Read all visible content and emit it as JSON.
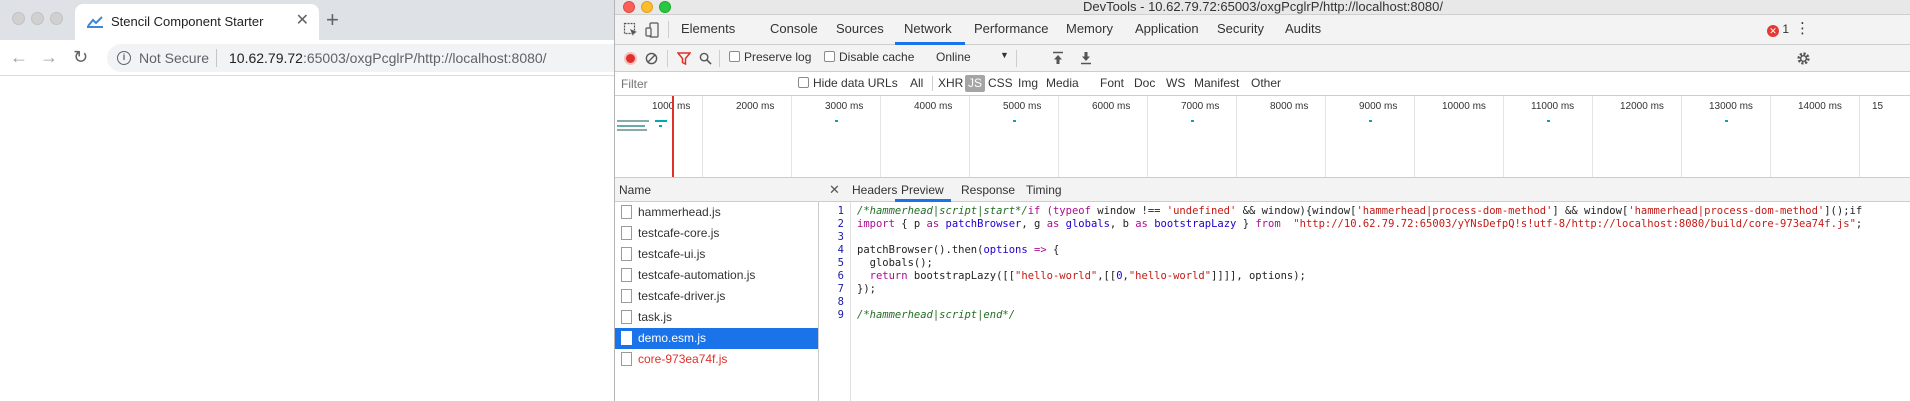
{
  "browser": {
    "tab_title": "Stencil Component Starter",
    "not_secure": "Not Secure",
    "url_host": "10.62.79.72",
    "url_rest": ":65003/oxgPcglrP/http://localhost:8080/"
  },
  "devtools": {
    "window_title": "DevTools - 10.62.79.72:65003/oxgPcglrP/http://localhost:8080/",
    "tabs": [
      "Elements",
      "Console",
      "Sources",
      "Network",
      "Performance",
      "Memory",
      "Application",
      "Security",
      "Audits"
    ],
    "active_tab": "Network",
    "error_count": "1",
    "network_toolbar": {
      "preserve_log": "Preserve log",
      "disable_cache": "Disable cache",
      "throttle": "Online"
    },
    "filter": {
      "placeholder": "Filter",
      "hide_data_urls": "Hide data URLs",
      "types": [
        "All",
        "XHR",
        "JS",
        "CSS",
        "Img",
        "Media",
        "Font",
        "Doc",
        "WS",
        "Manifest",
        "Other"
      ],
      "selected_type": "JS"
    },
    "overview_ticks": [
      "1000 ms",
      "2000 ms",
      "3000 ms",
      "4000 ms",
      "5000 ms",
      "6000 ms",
      "7000 ms",
      "8000 ms",
      "9000 ms",
      "10000 ms",
      "11000 ms",
      "12000 ms",
      "13000 ms",
      "14000 ms",
      "15"
    ],
    "name_header": "Name",
    "requests": [
      {
        "name": "hammerhead.js",
        "state": "normal"
      },
      {
        "name": "testcafe-core.js",
        "state": "normal"
      },
      {
        "name": "testcafe-ui.js",
        "state": "normal"
      },
      {
        "name": "testcafe-automation.js",
        "state": "normal"
      },
      {
        "name": "testcafe-driver.js",
        "state": "normal"
      },
      {
        "name": "task.js",
        "state": "normal"
      },
      {
        "name": "demo.esm.js",
        "state": "selected"
      },
      {
        "name": "core-973ea74f.js",
        "state": "error"
      }
    ],
    "detail_tabs": [
      "Headers",
      "Preview",
      "Response",
      "Timing"
    ],
    "active_detail_tab": "Preview",
    "line_numbers": [
      "1",
      "2",
      "3",
      "4",
      "5",
      "6",
      "7",
      "8",
      "9"
    ],
    "code": {
      "l1_comment": "/*hammerhead|script|start*/",
      "l1_rest_a": "if (",
      "l1_typeof": "typeof",
      "l1_rest_b": " window !== ",
      "l1_str1": "'undefined'",
      "l1_rest_c": " && window){window[",
      "l1_str2": "'hammerhead|process-dom-method'",
      "l1_rest_d": "] && window[",
      "l1_str3": "'hammerhead|process-dom-method'",
      "l1_rest_e": "]();if",
      "l2_import": "import",
      "l2_rest_a": " { p ",
      "l2_as1": "as",
      "l2_v1": " patchBrowser",
      "l2_rest_b": ", g ",
      "l2_as2": "as",
      "l2_v2": " globals",
      "l2_rest_c": ", b ",
      "l2_as3": "as",
      "l2_v3": " bootstrapLazy",
      "l2_rest_d": " } ",
      "l2_from": "from",
      "l2_str": "  \"http://10.62.79.72:65003/yYNsDefpQ!s!utf-8/http://localhost:8080/build/core-973ea74f.js\"",
      "l2_end": ";",
      "l4_a": "patchBrowser().then(",
      "l4_opt": "options",
      "l4_arrow": " => ",
      "l4_b": "{",
      "l5": "  globals();",
      "l6_ret": "  return",
      "l6_a": " bootstrapLazy([[",
      "l6_s1": "\"hello-world\"",
      "l6_b": ",[[",
      "l6_n0": "0",
      "l6_c": ",",
      "l6_s2": "\"hello-world\"",
      "l6_d": "]]]], options);",
      "l7": "});",
      "l9_comment": "/*hammerhead|script|end*/"
    }
  }
}
